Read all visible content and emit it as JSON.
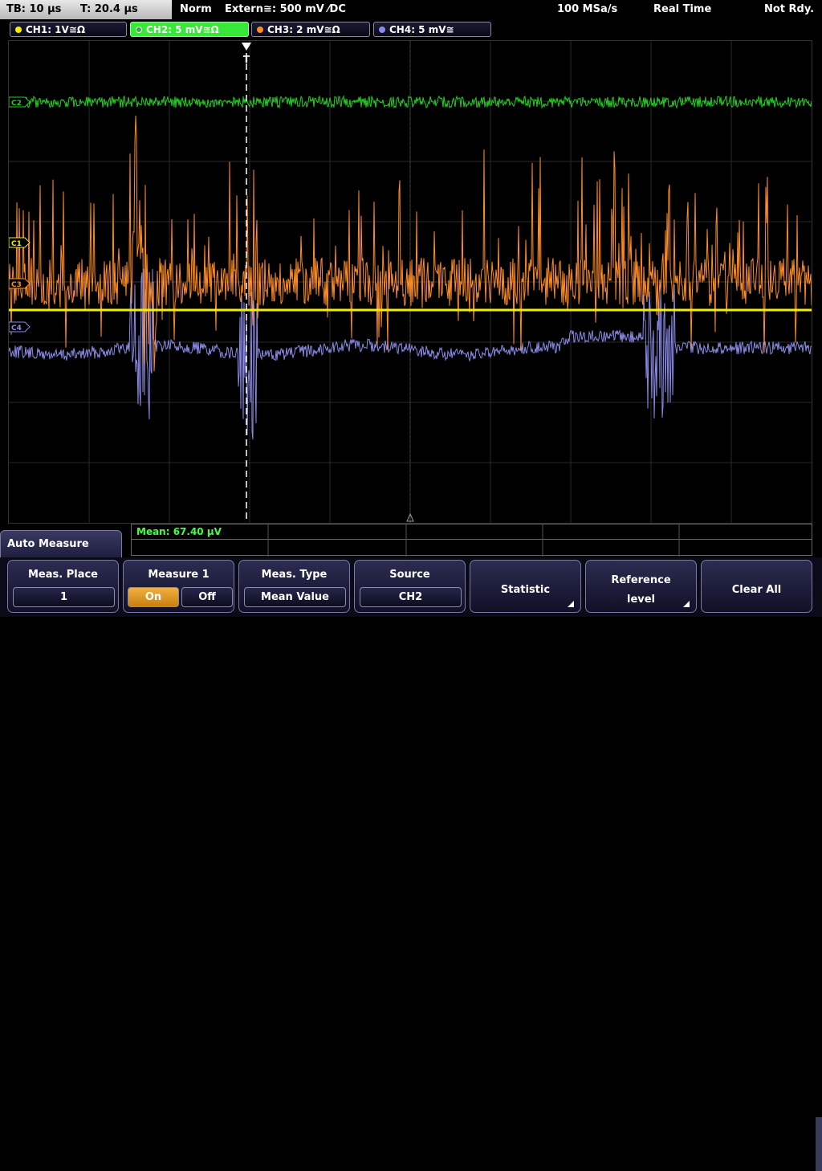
{
  "topbar": {
    "tb": "TB: 10 µs",
    "t": "T: 20.4 µs",
    "mode": "Norm",
    "trigger": "Extern≅: 500 mV ⁄DC",
    "rate": "100 MSa/s",
    "acq": "Real Time",
    "status": "Not Rdy."
  },
  "channels": [
    {
      "label": "CH1: 1V≅Ω",
      "color": "#f0f000"
    },
    {
      "label": "CH2: 5 mV≅Ω",
      "color": "#00d000"
    },
    {
      "label": "CH3: 2 mV≅Ω",
      "color": "#ff8c28"
    },
    {
      "label": "CH4: 5 mV≅",
      "color": "#8a8ae8"
    }
  ],
  "markers": {
    "ch1": "C1",
    "ch2": "C2",
    "ch3": "C3",
    "ch4": "C4",
    "trigger": "T"
  },
  "measurement": {
    "text": "Mean: 67.40 µV"
  },
  "menu": {
    "title": "Auto Measure"
  },
  "softkeys": {
    "meas_place": {
      "label": "Meas. Place",
      "value": "1"
    },
    "measure1": {
      "label": "Measure 1",
      "on": "On",
      "off": "Off"
    },
    "meas_type": {
      "label": "Meas. Type",
      "value": "Mean Value"
    },
    "source": {
      "label": "Source",
      "value": "CH2"
    },
    "statistic": {
      "label": "Statistic"
    },
    "reference": {
      "label1": "Reference",
      "label2": "level"
    },
    "clear_all": {
      "label": "Clear All"
    }
  }
}
